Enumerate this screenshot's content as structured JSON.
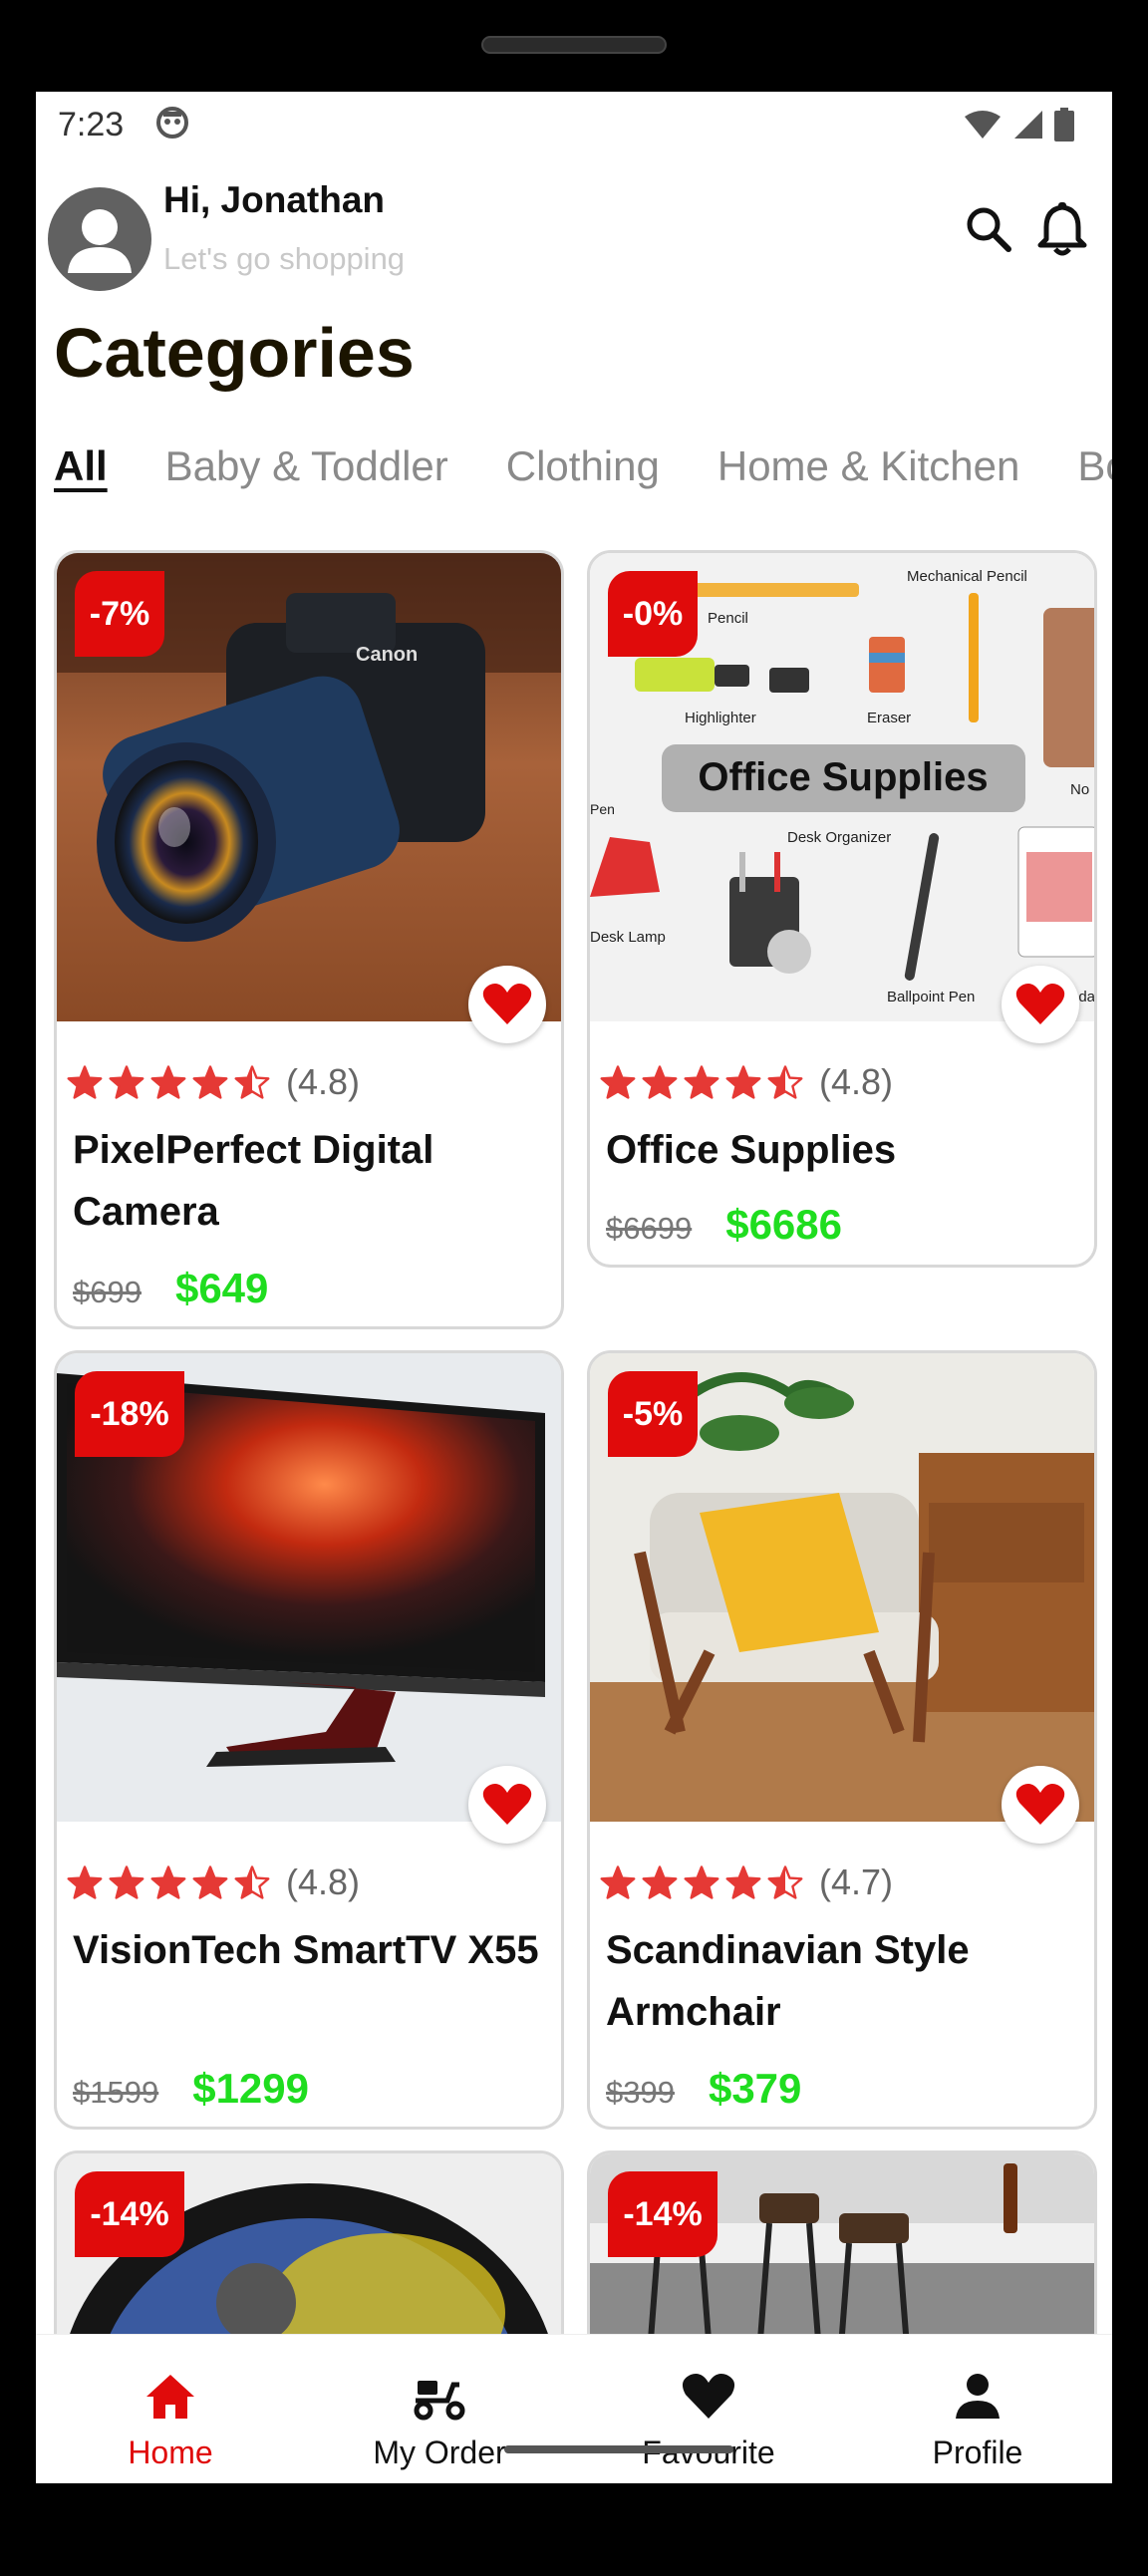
{
  "status_bar": {
    "time": "7:23"
  },
  "header": {
    "greeting": "Hi, Jonathan",
    "subtitle": "Let's go shopping"
  },
  "categories": {
    "title": "Categories",
    "tabs": [
      "All",
      "Baby & Toddler",
      "Clothing",
      "Home & Kitchen",
      "Bo"
    ]
  },
  "products": [
    {
      "name": "PixelPerfect Digital Camera",
      "discount": "-7%",
      "rating": "(4.8)",
      "stars": 4.5,
      "old_price": "$699",
      "price": "$649"
    },
    {
      "name": "Office Supplies",
      "discount": "-0%",
      "rating": "(4.8)",
      "stars": 4.5,
      "old_price": "$6699",
      "price": "$6686",
      "image_text": {
        "title": "Office Supplies",
        "labels": [
          "Mechanical Pencil",
          "Pencil",
          "Highlighter",
          "Eraser",
          "Desk Organizer",
          "Desk Lamp",
          "Ballpoint Pen",
          "Pen",
          "No",
          "nda"
        ]
      }
    },
    {
      "name": "VisionTech SmartTV X55",
      "discount": "-18%",
      "rating": "(4.8)",
      "stars": 4.5,
      "old_price": "$1599",
      "price": "$1299"
    },
    {
      "name": "Scandinavian Style Armchair",
      "discount": "-5%",
      "rating": "(4.7)",
      "stars": 4.5,
      "old_price": "$399",
      "price": "$379"
    },
    {
      "discount": "-14%"
    },
    {
      "discount": "-14%"
    }
  ],
  "bottom_nav": [
    {
      "label": "Home",
      "icon": "home-icon",
      "active": true
    },
    {
      "label": "My Order",
      "icon": "delivery-scooter-icon",
      "active": false
    },
    {
      "label": "Favourite",
      "icon": "heart-icon",
      "active": false
    },
    {
      "label": "Profile",
      "icon": "person-icon",
      "active": false
    }
  ],
  "colors": {
    "accent": "#e00b0b",
    "price_green": "#1fdd1f",
    "star": "#e53935"
  }
}
